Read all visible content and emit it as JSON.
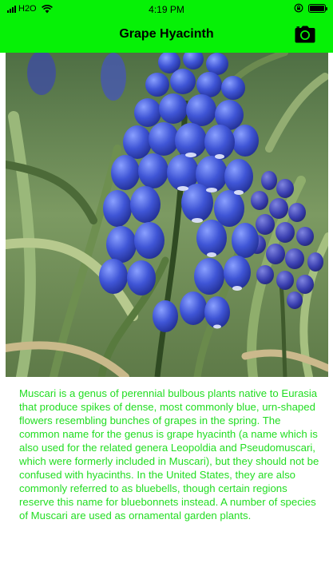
{
  "status_bar": {
    "carrier": "H2O",
    "time": "4:19 PM",
    "icons": [
      "signal-icon",
      "wifi-icon",
      "orientation-lock-icon",
      "battery-icon"
    ]
  },
  "nav": {
    "title": "Grape Hyacinth",
    "camera_icon": "camera-icon"
  },
  "colors": {
    "nav_background": "#06f106",
    "description_text": "#22dd22"
  },
  "photo": {
    "subject": "grape hyacinth flower"
  },
  "description": "Muscari is a genus of perennial bulbous plants native to Eurasia that produce spikes of dense, most commonly blue, urn-shaped flowers resembling bunches of grapes in the spring. The common name for the genus is grape hyacinth (a name which is also used for the related genera Leopoldia and Pseudomuscari, which were formerly included in Muscari), but they should not be confused with hyacinths. In the United States, they are also commonly referred to as bluebells, though certain regions reserve this name for bluebonnets instead. A number of species of Muscari are used as ornamental garden plants."
}
